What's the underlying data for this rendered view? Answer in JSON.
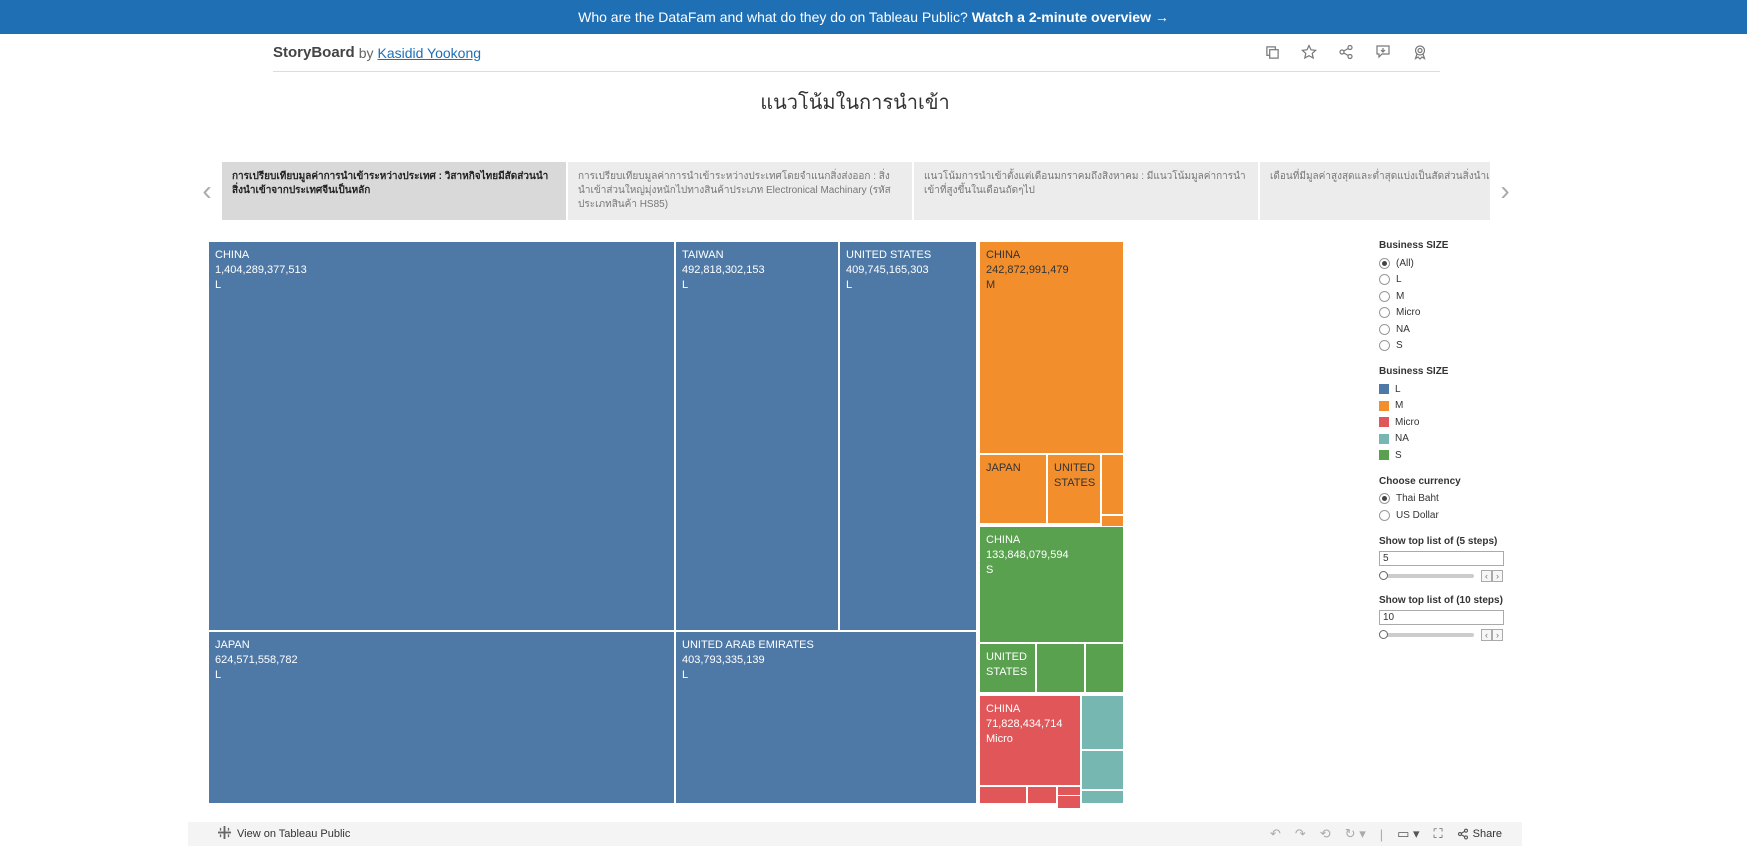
{
  "banner": {
    "text": "Who are the DataFam and what do they do on Tableau Public?",
    "link": "Watch a 2-minute overview →"
  },
  "header": {
    "brand": "StoryBoard",
    "by": "by",
    "author": "Kasidid Yookong",
    "icons": [
      "copy-icon",
      "star-icon",
      "share-nodes-icon",
      "comment-icon",
      "badge-icon"
    ]
  },
  "story": {
    "title": "แนวโน้มในการนำเข้า",
    "points": [
      "การเปรียบเทียบมูลค่าการนำเข้าระหว่างประเทศ : วิสาหกิจไทยมีสัดส่วนนำสิ่งนำเข้าจากประเทศจีนเป็นหลัก",
      "การเปรียบเทียบมูลค่าการนำเข้าระหว่างประเทศโดยจำแนกสิ่งส่งออก : สิ่งนำเข้าส่วนใหญ่มุ่งหนักไปทางสินค้าประเภท Electronical Machinary (รหัสประเภทสินค้า HS85)",
      "แนวโน้มการนำเข้าตั้งแต่เดือนมกราคมถึงสิงหาคม : มีแนวโน้มมูลค่าการนำเข้าที่สูงขึ้นในเดือนถัดๆไป",
      "เดือนที่มีมูลค่าสูงสุดและต่ำสุดแบ่งเป็นสัดส่วนสิ่งนำเข้า"
    ]
  },
  "colors": {
    "L": "#4e79a7",
    "M": "#f28e2b",
    "Micro": "#e15759",
    "NA": "#76b7b2",
    "S": "#59a14f"
  },
  "treemap": {
    "cells": [
      {
        "country": "CHINA",
        "value": "1,404,289,377,513",
        "size": "L"
      },
      {
        "country": "TAIWAN",
        "value": "492,818,302,153",
        "size": "L"
      },
      {
        "country": "UNITED STATES",
        "value": "409,745,165,303",
        "size": "L"
      },
      {
        "country": "JAPAN",
        "value": "624,571,558,782",
        "size": "L"
      },
      {
        "country": "UNITED ARAB EMIRATES",
        "value": "403,793,335,139",
        "size": "L"
      },
      {
        "country": "CHINA",
        "value": "242,872,991,479",
        "size": "M"
      },
      {
        "country": "JAPAN",
        "value": "",
        "size": ""
      },
      {
        "country": "UNITED STATES",
        "value": "",
        "size": ""
      },
      {
        "country": "CHINA",
        "value": "133,848,079,594",
        "size": "S"
      },
      {
        "country": "UNITED STATES",
        "value": "",
        "size": ""
      },
      {
        "country": "CHINA",
        "value": "71,828,434,714",
        "size": "Micro"
      }
    ]
  },
  "filters": {
    "size_filter_title": "Business SIZE",
    "size_options": [
      "(All)",
      "L",
      "M",
      "Micro",
      "NA",
      "S"
    ],
    "size_selected": "(All)",
    "legend_title": "Business SIZE",
    "legend_items": [
      "L",
      "M",
      "Micro",
      "NA",
      "S"
    ],
    "currency_title": "Choose currency",
    "currency_options": [
      "Thai Baht",
      "US Dollar"
    ],
    "currency_selected": "Thai Baht",
    "top5_title": "Show top list of (5 steps)",
    "top5_value": "5",
    "top10_title": "Show top list of (10 steps)",
    "top10_value": "10"
  },
  "toolbar": {
    "view_on": "View on Tableau Public",
    "share": "Share"
  }
}
